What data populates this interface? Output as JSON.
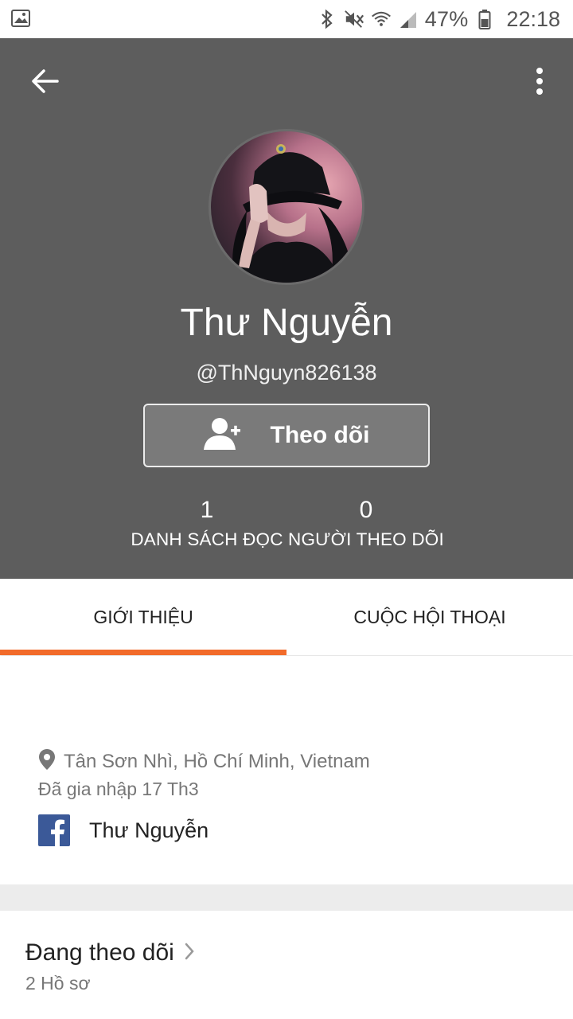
{
  "status_bar": {
    "battery_percent": "47%",
    "time": "22:18",
    "icons": [
      "gallery-icon",
      "bluetooth-icon",
      "mute-icon",
      "wifi-icon",
      "signal-icon",
      "battery-icon"
    ]
  },
  "header": {
    "back_icon": "arrow-left-icon",
    "more_icon": "more-vertical-icon",
    "background_color": "#5d5d5d"
  },
  "profile": {
    "display_name": "Thư Nguyễn",
    "username": "@ThNguyn826138",
    "follow_button_label": "Theo dõi",
    "follow_icon": "add-user-icon"
  },
  "stats": [
    {
      "value": "1",
      "label": "DANH SÁCH ĐỌC"
    },
    {
      "value": "0",
      "label": "NGƯỜI THEO DÕI"
    }
  ],
  "tabs": [
    {
      "label": "GIỚI THIỆU",
      "active": true
    },
    {
      "label": "CUỘC HỘI THOẠI",
      "active": false
    }
  ],
  "about": {
    "location": "Tân Sơn Nhì, Hồ Chí Minh, Vietnam",
    "joined": "Đã gia nhập 17 Th3",
    "facebook_name": "Thư Nguyễn"
  },
  "following": {
    "title": "Đang theo dõi",
    "count": "2 Hồ sơ"
  },
  "colors": {
    "accent": "#f26b2a",
    "facebook": "#3b5998"
  }
}
